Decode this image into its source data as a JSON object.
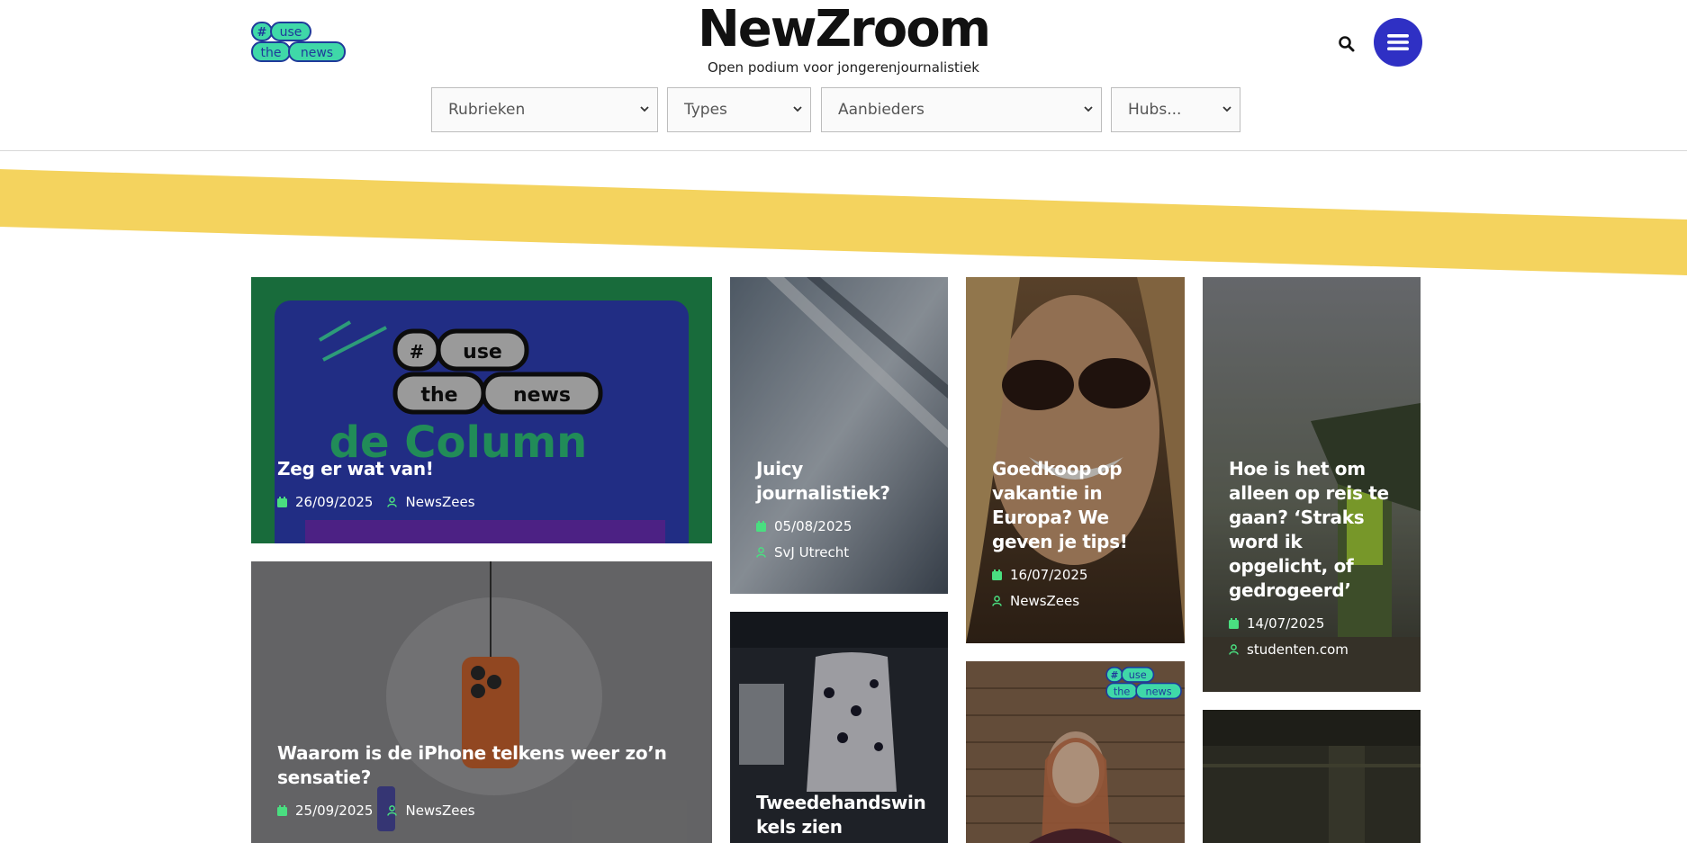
{
  "site": {
    "title": "NewZroom",
    "tagline": "Open podium voor jongerenjournalistiek",
    "logo": {
      "hash": "#",
      "line1": "use",
      "line2a": "the",
      "line2b": "news"
    }
  },
  "filters": [
    {
      "label": "Rubrieken"
    },
    {
      "label": "Types"
    },
    {
      "label": "Aanbieders"
    },
    {
      "label": "Hubs..."
    }
  ],
  "colors": {
    "accent": "#2f30c4",
    "stripe": "#f4d35e",
    "meta_icon": "#4ade80",
    "logo_green": "#3fd8a8",
    "logo_blue": "#1f3a9a"
  },
  "icons": {
    "search": "search-icon",
    "menu": "hamburger-icon",
    "date": "calendar-icon",
    "author": "user-icon"
  },
  "articles": [
    {
      "title": "Zeg er wat van!",
      "date": "26/09/2025",
      "author": "NewsZees",
      "image_text": "de Column"
    },
    {
      "title": "Juicy journalistiek?",
      "date": "05/08/2025",
      "author": "SvJ Utrecht"
    },
    {
      "title": "Goedkoop op vakantie in Europa? We geven je tips!",
      "date": "16/07/2025",
      "author": "NewsZees"
    },
    {
      "title": "Hoe is het om alleen op reis te gaan? ‘Straks word ik opgelicht, of gedrogeerd’",
      "date": "14/07/2025",
      "author": "studenten.com"
    },
    {
      "title": "Waarom is de iPhone telkens weer zo’n sensatie?",
      "date": "25/09/2025",
      "author": "NewsZees"
    },
    {
      "title": "Tweedehandswinkels zien",
      "date": "",
      "author": ""
    },
    {
      "title": "",
      "date": "",
      "author": ""
    },
    {
      "title": "",
      "date": "",
      "author": ""
    }
  ]
}
